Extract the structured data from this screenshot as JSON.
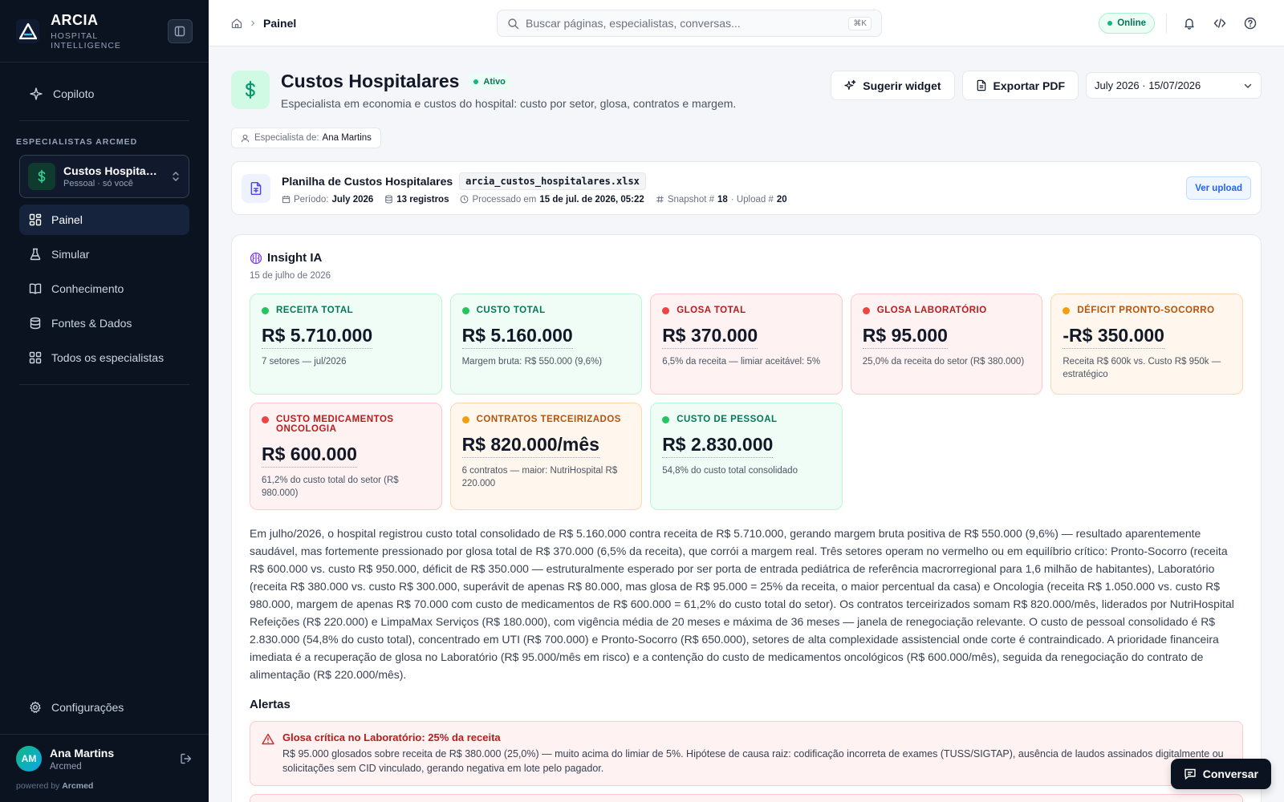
{
  "brand": {
    "name": "ARCIA",
    "subtitle": "HOSPITAL INTELLIGENCE"
  },
  "sidebar": {
    "copilot_label": "Copiloto",
    "section_title": "ESPECIALISTAS ARCMED",
    "specialist": {
      "name": "Custos Hospitalares",
      "sub": "Pessoal · só você"
    },
    "items": [
      {
        "label": "Painel",
        "icon": "dashboard-icon",
        "active": true
      },
      {
        "label": "Simular",
        "icon": "flask-icon"
      },
      {
        "label": "Conhecimento",
        "icon": "book-icon"
      },
      {
        "label": "Fontes & Dados",
        "icon": "database-icon"
      },
      {
        "label": "Todos os especialistas",
        "icon": "grid-icon"
      }
    ],
    "settings_label": "Configurações",
    "user": {
      "initials": "AM",
      "name": "Ana Martins",
      "org": "Arcmed"
    },
    "powered_prefix": "powered by",
    "powered_brand": "Arcmed"
  },
  "topbar": {
    "breadcrumb": "Painel",
    "search_placeholder": "Buscar páginas, especialistas, conversas...",
    "search_shortcut": "⌘K",
    "status": "Online"
  },
  "header": {
    "title": "Custos Hospitalares",
    "status_badge": "Ativo",
    "description": "Especialista em economia e custos do hospital: custo por setor, glosa, contratos e margem.",
    "suggest_label": "Sugerir widget",
    "export_label": "Exportar PDF",
    "date_value": "July 2026 · 15/07/2026",
    "owner_prefix": "Especialista de:",
    "owner_name": "Ana Martins"
  },
  "upload": {
    "title": "Planilha de Custos Hospitalares",
    "filename": "arcia_custos_hospitalares.xlsx",
    "period_label": "Período:",
    "period_value": "July 2026",
    "records": "13 registros",
    "processed_label": "Processado em",
    "processed_value": "15 de jul. de 2026, 05:22",
    "snapshot_label": "Snapshot #",
    "snapshot_value": "18",
    "upload_label": "· Upload #",
    "upload_value": "20",
    "view_label": "Ver upload"
  },
  "insight": {
    "title": "Insight IA",
    "date": "15 de julho de 2026",
    "kpis": [
      {
        "label": "RECEITA TOTAL",
        "value": "R$ 5.710.000",
        "note": "7 setores — jul/2026",
        "tone": "green"
      },
      {
        "label": "CUSTO TOTAL",
        "value": "R$ 5.160.000",
        "note": "Margem bruta: R$ 550.000 (9,6%)",
        "tone": "green"
      },
      {
        "label": "GLOSA TOTAL",
        "value": "R$ 370.000",
        "note": "6,5% da receita — limiar aceitável: 5%",
        "tone": "red"
      },
      {
        "label": "GLOSA LABORATÓRIO",
        "value": "R$ 95.000",
        "note": "25,0% da receita do setor (R$ 380.000)",
        "tone": "red"
      },
      {
        "label": "DÉFICIT PRONTO-SOCORRO",
        "value": "-R$ 350.000",
        "note": "Receita R$ 600k vs. Custo R$ 950k — estratégico",
        "tone": "orange"
      },
      {
        "label": "CUSTO MEDICAMENTOS ONCOLOGIA",
        "value": "R$ 600.000",
        "note": "61,2% do custo total do setor (R$ 980.000)",
        "tone": "red"
      },
      {
        "label": "CONTRATOS TERCEIRIZADOS",
        "value": "R$ 820.000/mês",
        "note": "6 contratos — maior: NutriHospital R$ 220.000",
        "tone": "orange"
      },
      {
        "label": "CUSTO DE PESSOAL",
        "value": "R$ 2.830.000",
        "note": "54,8% do custo total consolidado",
        "tone": "green"
      }
    ],
    "text": "Em julho/2026, o hospital registrou custo total consolidado de R$ 5.160.000 contra receita de R$ 5.710.000, gerando margem bruta positiva de R$ 550.000 (9,6%) — resultado aparentemente saudável, mas fortemente pressionado por glosa total de R$ 370.000 (6,5% da receita), que corrói a margem real. Três setores operam no vermelho ou em equilíbrio crítico: Pronto-Socorro (receita R$ 600.000 vs. custo R$ 950.000, déficit de R$ 350.000 — estruturalmente esperado por ser porta de entrada pediátrica de referência macrorregional para 1,6 milhão de habitantes), Laboratório (receita R$ 380.000 vs. custo R$ 300.000, superávit de apenas R$ 80.000, mas glosa de R$ 95.000 = 25% da receita, o maior percentual da casa) e Oncologia (receita R$ 1.050.000 vs. custo R$ 980.000, margem de apenas R$ 70.000 com custo de medicamentos de R$ 600.000 = 61,2% do custo total do setor). Os contratos terceirizados somam R$ 820.000/mês, liderados por NutriHospital Refeições (R$ 220.000) e LimpaMax Serviços (R$ 180.000), com vigência média de 20 meses e máxima de 36 meses — janela de renegociação relevante. O custo de pessoal consolidado é R$ 2.830.000 (54,8% do custo total), concentrado em UTI (R$ 700.000) e Pronto-Socorro (R$ 650.000), setores de alta complexidade assistencial onde corte é contraindicado. A prioridade financeira imediata é a recuperação de glosa no Laboratório (R$ 95.000/mês em risco) e a contenção do custo de medicamentos oncológicos (R$ 600.000/mês), seguida da renegociação do contrato de alimentação (R$ 220.000/mês).",
    "alerts_title": "Alertas",
    "alerts": [
      {
        "title": "Glosa crítica no Laboratório: 25% da receita",
        "text": "R$ 95.000 glosados sobre receita de R$ 380.000 (25,0%) — muito acima do limiar de 5%. Hipótese de causa raiz: codificação incorreta de exames (TUSS/SIGTAP), ausência de laudos assinados digitalmente ou solicitações sem CID vinculado, gerando negativa em lote pelo pagador."
      }
    ]
  },
  "chat_label": "Conversar"
}
